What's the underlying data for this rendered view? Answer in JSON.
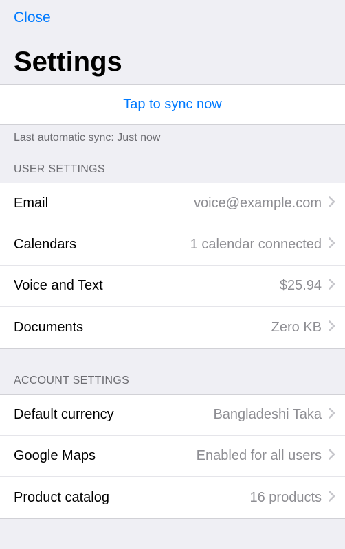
{
  "header": {
    "close_label": "Close",
    "title": "Settings"
  },
  "sync": {
    "button_label": "Tap to sync now",
    "status": "Last automatic sync: Just now"
  },
  "sections": {
    "user": {
      "title": "USER SETTINGS",
      "items": [
        {
          "label": "Email",
          "value": "voice@example.com"
        },
        {
          "label": "Calendars",
          "value": "1 calendar connected"
        },
        {
          "label": "Voice and Text",
          "value": "$25.94"
        },
        {
          "label": "Documents",
          "value": "Zero KB"
        }
      ]
    },
    "account": {
      "title": "ACCOUNT SETTINGS",
      "items": [
        {
          "label": "Default currency",
          "value": "Bangladeshi Taka"
        },
        {
          "label": "Google Maps",
          "value": "Enabled for all users"
        },
        {
          "label": "Product catalog",
          "value": "16 products"
        }
      ]
    }
  }
}
